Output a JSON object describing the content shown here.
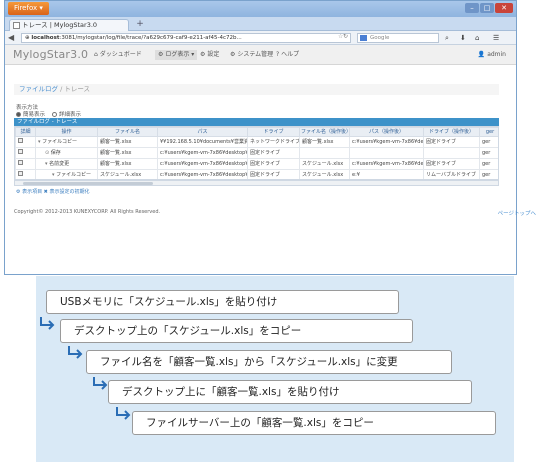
{
  "browser": {
    "firefox_label": "Firefox ▾",
    "tab_title": "トレース | MylogStar3.0",
    "newtab": "+",
    "url_host": "localhost",
    "url_rest": ":3081/mylogstar/log/file/trace/?a629c679-caf9-e211-af45-4c72b...",
    "search_placeholder": "Google",
    "win_min": "–",
    "win_max": "□",
    "win_close": "✕"
  },
  "app": {
    "brand": "MylogStar3.0",
    "menu": [
      {
        "icon": "home-icon",
        "glyph": "⌂",
        "label": "ダッシュボード",
        "active": false
      },
      {
        "icon": "gear-icon",
        "glyph": "⚙",
        "label": "ログ表示 ▾",
        "active": true
      },
      {
        "icon": "settings-icon",
        "glyph": "⚙",
        "label": "設定",
        "active": false
      },
      {
        "icon": "system-icon",
        "glyph": "⚙",
        "label": "システム管理",
        "active": false
      },
      {
        "icon": "help-icon",
        "glyph": "?",
        "label": "ヘルプ",
        "active": false
      }
    ],
    "user": "admin"
  },
  "breadcrumb": {
    "root": "ファイルログ",
    "sep": "/",
    "current": "トレース"
  },
  "display_mode": {
    "label": "表示方法",
    "option1": "簡易表示",
    "option2": "詳細表示",
    "selected": "option1"
  },
  "grid": {
    "title": "ファイルログ - トレース",
    "columns": [
      "詳細",
      "操作",
      "ファイル名",
      "パス",
      "ドライブ",
      "ファイル名（操作後）",
      "パス（操作後）",
      "ドライブ（操作後）",
      "ger"
    ],
    "rows": [
      {
        "op": "ファイルコピー",
        "indent": 0,
        "toggle": "▾",
        "file": "顧客一覧.xlsx",
        "path": "¥¥192.168.5.10¥documents¥営業資料¥",
        "drive": "ネットワークドライブ",
        "file2": "顧客一覧.xlsx",
        "path2": "c:¥users¥kgem-vm-7x86¥desktop¥",
        "drive2": "固定ドライブ",
        "extra": "ger",
        "hl": false
      },
      {
        "op": "保存",
        "indent": 1,
        "toggle": "⊙",
        "file": "顧客一覧.xlsx",
        "path": "c:¥users¥kgem-vm-7x86¥desktop¥",
        "drive": "固定ドライブ",
        "file2": "",
        "path2": "",
        "drive2": "",
        "extra": "ger",
        "hl": false
      },
      {
        "op": "名前変更",
        "indent": 1,
        "toggle": "▾",
        "file": "顧客一覧.xlsx",
        "path": "c:¥users¥kgem-vm-7x86¥desktop¥",
        "drive": "固定ドライブ",
        "file2": "スケジュール.xlsx",
        "path2": "c:¥users¥kgem-vm-7x86¥desktop¥",
        "drive2": "固定ドライブ",
        "extra": "ger",
        "hl": false
      },
      {
        "op": "ファイルコピー",
        "indent": 2,
        "toggle": "▾",
        "file": "スケジュール.xlsx",
        "path": "c:¥users¥kgem-vm-7x86¥desktop¥",
        "drive": "固定ドライブ",
        "file2": "スケジュール.xlsx",
        "path2": "e:¥",
        "drive2": "リムーバブルドライブ",
        "extra": "ger",
        "hl": false
      },
      {
        "op": "保存",
        "indent": 3,
        "toggle": "⊙",
        "file": "スケジュール.xlsx",
        "path": "e:¥",
        "drive": "リムーバブルドライブ",
        "file2": "",
        "path2": "",
        "drive2": "",
        "extra": "ger",
        "hl": true
      },
      {
        "op": "削除",
        "indent": 1,
        "toggle": "⊙",
        "file": "スケジュール.xlsx",
        "path": "c:¥users¥kgem-vm-7x86¥desktop¥",
        "drive": "固定ドライブ",
        "file2": "",
        "path2": "",
        "drive2": "",
        "extra": "ger",
        "hl": false
      }
    ],
    "footer": "⚙ 表示項目 ✖ 表示設定の初期化"
  },
  "footer": {
    "copyright": "Copyright© 2012-2013 KUNEXYCORP. All Rights Reserved.",
    "pagetop": "ページトップへ"
  },
  "steps": [
    "USBメモリに「スケジュール.xls」を貼り付け",
    "デスクトップ上の「スケジュール.xls」をコピー",
    "ファイル名を「顧客一覧.xls」から「スケジュール.xls」に変更",
    "デスクトップ上に「顧客一覧.xls」を貼り付け",
    "ファイルサーバー上の「顧客一覧.xls」をコピー"
  ],
  "colors": {
    "grid_header": "#3d92c9",
    "highlight_row": "#fbe89a",
    "steps_bg": "#d9e9f6",
    "arrow": "#2a6db5"
  }
}
